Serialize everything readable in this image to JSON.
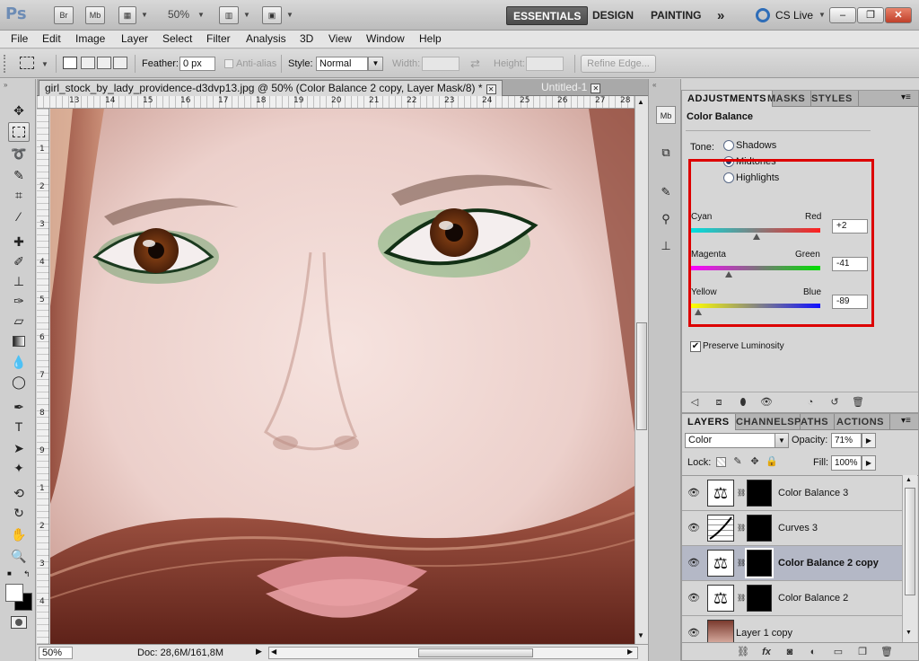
{
  "appbar": {
    "logo": "Ps",
    "icons": [
      "Br",
      "Mb"
    ],
    "zoom": "50%",
    "workspaces": [
      "ESSENTIALS",
      "DESIGN",
      "PAINTING"
    ],
    "more": "»",
    "cslive": "CS Live",
    "window_buttons": [
      "–",
      "❐",
      "✕"
    ]
  },
  "menu": [
    "File",
    "Edit",
    "Image",
    "Layer",
    "Select",
    "Filter",
    "Analysis",
    "3D",
    "View",
    "Window",
    "Help"
  ],
  "options": {
    "feather_label": "Feather:",
    "feather_value": "0 px",
    "antialias_label": "Anti-alias",
    "style_label": "Style:",
    "style_value": "Normal",
    "width_label": "Width:",
    "height_label": "Height:",
    "refine_edge": "Refine Edge..."
  },
  "doc_tabs": [
    {
      "label": "girl_stock_by_lady_providence-d3dvp13.jpg @ 50% (Color Balance 2 copy, Layer Mask/8) *"
    },
    {
      "label": "Untitled-1"
    }
  ],
  "ruler": {
    "h_ticks": [
      "13",
      "14",
      "15",
      "16",
      "17",
      "18",
      "19",
      "20",
      "21",
      "22",
      "23",
      "24",
      "25",
      "26",
      "27",
      "28"
    ],
    "v_ticks": [
      "1",
      "2",
      "3",
      "4",
      "5",
      "6",
      "7",
      "8",
      "9",
      "1",
      "2",
      "3",
      "4"
    ]
  },
  "status": {
    "zoom": "50%",
    "doc": "Doc: 28,6M/161,8M"
  },
  "adjustments": {
    "tabs": [
      "ADJUSTMENTS",
      "MASKS",
      "STYLES"
    ],
    "title": "Color Balance",
    "tone_label": "Tone:",
    "tones": [
      "Shadows",
      "Midtones",
      "Highlights"
    ],
    "selected_tone": "Midtones",
    "sliders": [
      {
        "left": "Cyan",
        "right": "Red",
        "value": "+2",
        "amount": 2
      },
      {
        "left": "Magenta",
        "right": "Green",
        "value": "-41",
        "amount": -41
      },
      {
        "left": "Yellow",
        "right": "Blue",
        "value": "-89",
        "amount": -89
      }
    ],
    "preserve": "Preserve Luminosity",
    "preserve_checked": true
  },
  "layers": {
    "tabs": [
      "LAYERS",
      "CHANNELS",
      "PATHS",
      "ACTIONS"
    ],
    "blend_mode": "Color",
    "opacity_label": "Opacity:",
    "opacity": "71%",
    "lock_label": "Lock:",
    "fill_label": "Fill:",
    "fill": "100%",
    "rows": [
      {
        "name": "Color Balance 3",
        "type": "balance",
        "selected": false
      },
      {
        "name": "Curves 3",
        "type": "curves",
        "selected": false
      },
      {
        "name": "Color Balance 2 copy",
        "type": "balance",
        "selected": true
      },
      {
        "name": "Color Balance 2",
        "type": "balance",
        "selected": false
      },
      {
        "name": "Layer 1 copy",
        "type": "image",
        "selected": false
      }
    ],
    "bottom_icons": [
      "link-icon",
      "fx-icon",
      "mask-icon",
      "adjustment-icon",
      "folder-icon",
      "new-layer-icon",
      "trash-icon"
    ],
    "fx_label": "fx"
  },
  "colors": {
    "highlight_box": "#dd0000",
    "selected_layer": "#b4b8c6"
  }
}
